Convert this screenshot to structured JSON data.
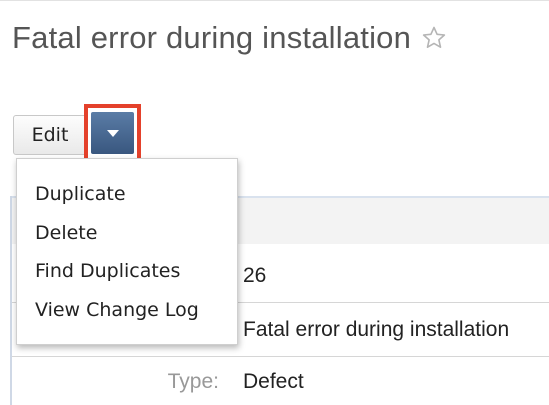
{
  "record": {
    "title": "Fatal error during installation",
    "favorite_icon": "star-outline-icon"
  },
  "actions": {
    "edit_label": "Edit",
    "dropdown_icon": "caret-down-icon",
    "highlight_color": "#e4412b",
    "menu_items": [
      {
        "label": "Duplicate"
      },
      {
        "label": "Delete"
      },
      {
        "label": "Find Duplicates"
      },
      {
        "label": "View Change Log"
      }
    ]
  },
  "details": {
    "rows": [
      {
        "label": "",
        "value": "26"
      },
      {
        "label": "",
        "value": "Fatal error during installation"
      },
      {
        "label": "Type:",
        "value": "Defect"
      }
    ]
  }
}
